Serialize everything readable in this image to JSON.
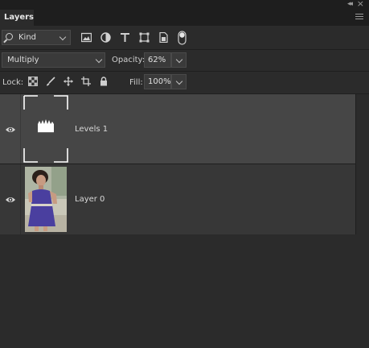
{
  "panel": {
    "title": "Layers",
    "collapse_glyph": "◂◂",
    "close_glyph": "×"
  },
  "filter": {
    "kind_label": "Kind",
    "icons": [
      "image-filter-icon",
      "adjustment-filter-icon",
      "type-filter-icon",
      "shape-filter-icon",
      "smart-object-filter-icon",
      "filter-toggle-icon"
    ]
  },
  "blend": {
    "mode": "Multiply",
    "opacity_label": "Opacity:",
    "opacity_value": "62%"
  },
  "lock": {
    "label": "Lock:",
    "icons": [
      "lock-transparent-pixels-icon",
      "lock-image-pixels-icon",
      "lock-position-icon",
      "lock-artboard-icon",
      "lock-all-icon"
    ],
    "fill_label": "Fill:",
    "fill_value": "100%"
  },
  "layers": [
    {
      "name": "Levels 1",
      "type": "adjustment",
      "selected": true,
      "visible": true
    },
    {
      "name": "Layer 0",
      "type": "pixel",
      "selected": false,
      "visible": true
    }
  ],
  "colors": {
    "panel_bg": "#2b2b2b",
    "selected_row": "#464646",
    "unselected_row": "#373737"
  }
}
